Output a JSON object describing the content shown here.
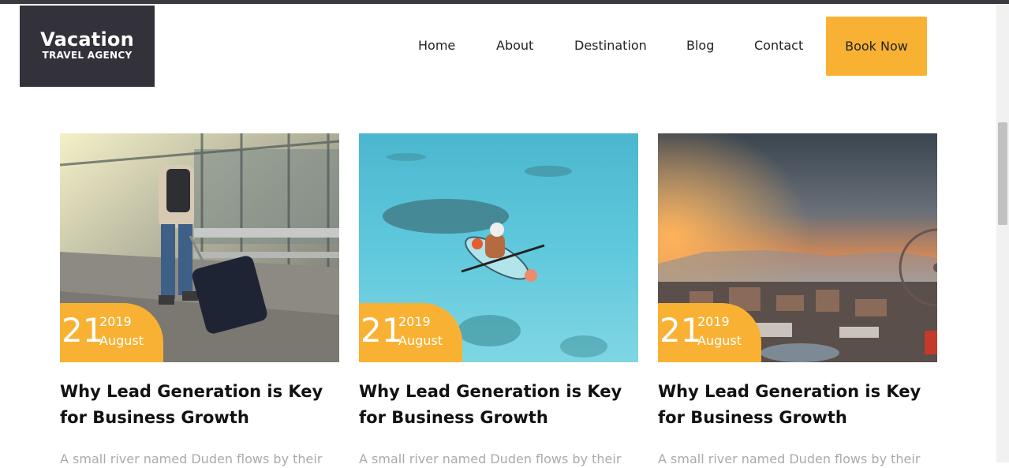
{
  "logo": {
    "title": "Vacation",
    "subtitle": "TRAVEL AGENCY"
  },
  "nav": {
    "items": [
      "Home",
      "About",
      "Destination",
      "Blog",
      "Contact"
    ],
    "cta": "Book Now"
  },
  "posts": [
    {
      "day": "21",
      "year": "2019",
      "month": "August",
      "title": "Why Lead Generation is Key for Business Growth",
      "excerpt": "A small river named Duden flows by their",
      "image": "traveler-with-suitcase-photo"
    },
    {
      "day": "21",
      "year": "2019",
      "month": "August",
      "title": "Why Lead Generation is Key for Business Growth",
      "excerpt": "A small river named Duden flows by their",
      "image": "kayak-in-turquoise-water-photo"
    },
    {
      "day": "21",
      "year": "2019",
      "month": "August",
      "title": "Why Lead Generation is Key for Business Growth",
      "excerpt": "A small river named Duden flows by their",
      "image": "sunset-city-ferris-wheel-photo"
    }
  ],
  "colors": {
    "accent": "#f8b133",
    "logo_bg": "#33323a"
  }
}
